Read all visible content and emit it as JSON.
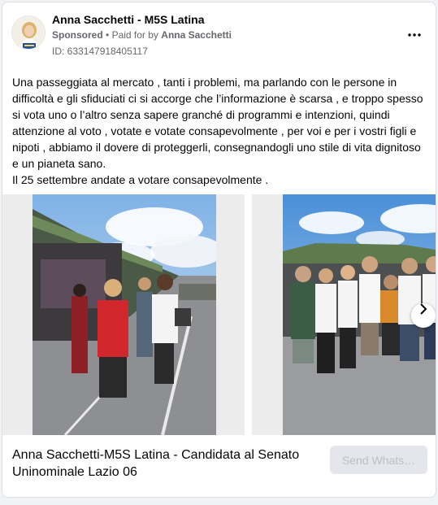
{
  "post": {
    "page_name": "Anna Sacchetti - M5S Latina",
    "sponsored_label": "Sponsored",
    "separator": "•",
    "paid_for_prefix": "Paid for by",
    "paid_for_name": "Anna Sacchetti",
    "ad_id": "ID: 633147918405117",
    "body_text": "Una passeggiata al mercato , tanti i problemi, ma parlando con le persone in difficoltà e gli sfiduciati ci si accorge che l’informazione è scarsa , e troppo spesso si vota uno o l’altro senza sapere granché di programmi e intenzioni, quindi attenzione al voto , votate e votate consapevolmente , per voi e per i vostri figli e nipoti , abbiamo il dovere di proteggerli, consegnandogli uno stile di vita dignitoso e un pianeta sano.\nIl 25 settembre andate a votare consapevolmente ."
  },
  "icons": {
    "avatar": "candidate-profile-photo",
    "more": "more-options-icon",
    "next": "chevron-right-icon"
  },
  "carousel": {
    "slides": [
      {
        "name": "market-stall-photo"
      },
      {
        "name": "group-photo"
      }
    ]
  },
  "footer": {
    "link_title": "Anna Sacchetti-M5S Latina - Candidata al Senato Uninominale Lazio 06",
    "cta_label": "Send Whats…"
  },
  "colors": {
    "secondary_text": "#65676b",
    "cta_background": "#e4e6eb",
    "cta_text": "#bcc0c4"
  }
}
